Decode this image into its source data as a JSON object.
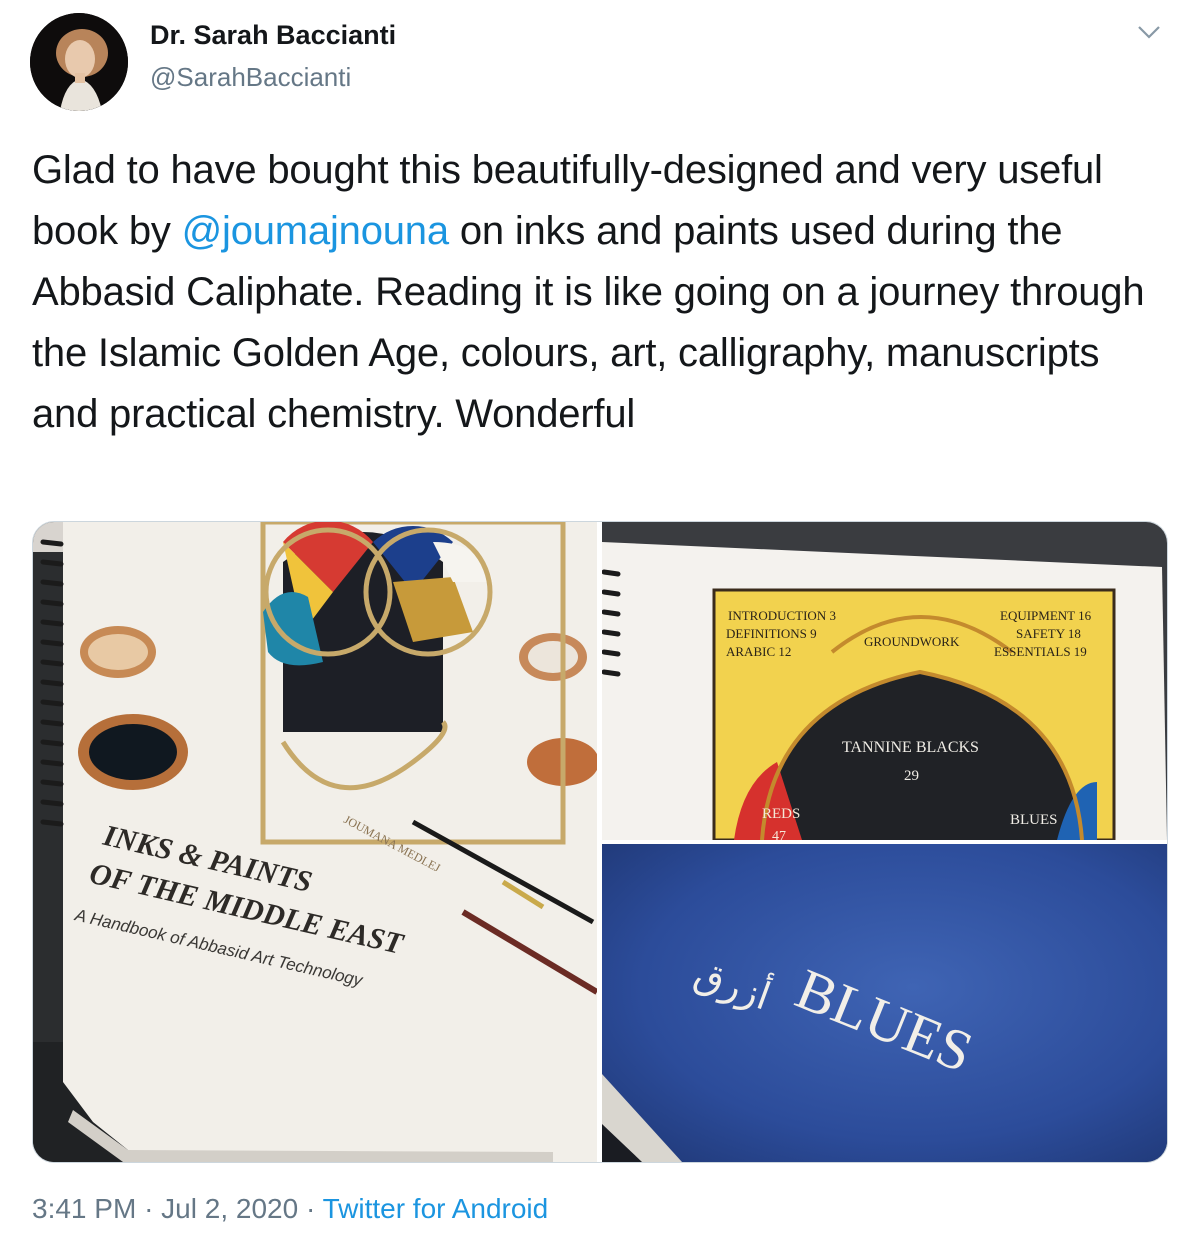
{
  "author": {
    "name": "Dr. Sarah Baccianti",
    "handle": "@SarahBaccianti"
  },
  "tweet": {
    "text_before": "Glad to have bought this beautifully-designed and very useful book by ",
    "mention": "@joumajnouna",
    "text_after": " on inks and paints used during the Abbasid Caliphate. Reading it is like going on a journey through the Islamic Golden Age, colours, art, calligraphy, manuscripts and practical chemistry. Wonderful"
  },
  "photos": {
    "cover": {
      "author_text": "JOUMANA MEDLEJ",
      "title_line1": "INKS & PAINTS",
      "title_line2": "OF THE MIDDLE EAST",
      "subtitle": "A Handbook of Abbasid Art Technology"
    },
    "contents": {
      "left_items": [
        "INTRODUCTION 3",
        "DEFINITIONS 9",
        "ARABIC 12"
      ],
      "right_items": [
        "EQUIPMENT 16",
        "SAFETY 18",
        "ESSENTIALS 19"
      ],
      "arc_label": "GROUNDWORK",
      "center_label": "TANNINE BLACKS",
      "center_page": "29",
      "reds": "REDS",
      "reds_page": "47",
      "blues": "BLUES"
    },
    "blues_page": {
      "arabic": "أزرق",
      "title": "BLUES"
    }
  },
  "meta": {
    "time": "3:41 PM",
    "separator": "·",
    "date": "Jul 2, 2020",
    "source": "Twitter for Android"
  },
  "colors": {
    "link": "#1b95e0",
    "secondary_text": "#657786",
    "primary_text": "#14171a"
  }
}
